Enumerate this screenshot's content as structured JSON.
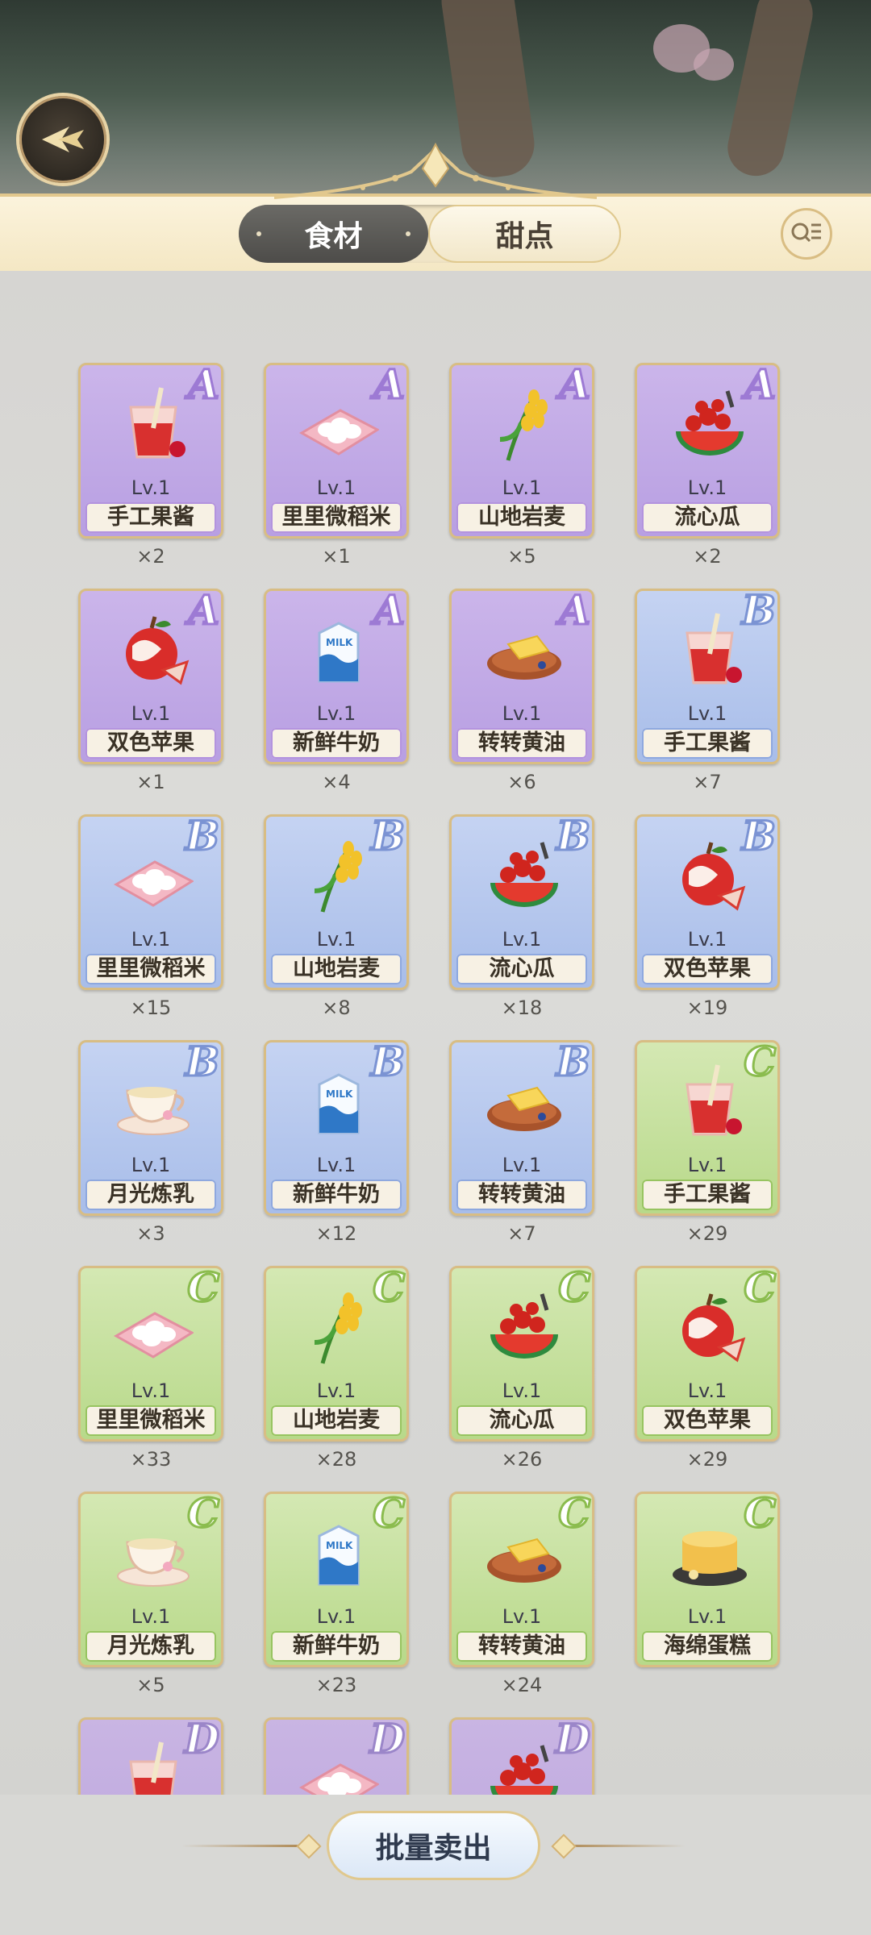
{
  "header": {
    "tabs": [
      {
        "label": "食材",
        "active": true
      },
      {
        "label": "甜点",
        "active": false
      }
    ]
  },
  "colors": {
    "rank_A": "#b89fe2",
    "rank_B": "#a8bde9",
    "rank_C": "#b8d98a",
    "rank_D": "#bca6de",
    "gold_trim": "#d8bd84"
  },
  "items": [
    {
      "name": "手工果酱",
      "level": "Lv.1",
      "rank": "A",
      "qty": "×2",
      "icon": "jam-drink-icon"
    },
    {
      "name": "里里微稻米",
      "level": "Lv.1",
      "rank": "A",
      "qty": "×1",
      "icon": "rice-icon"
    },
    {
      "name": "山地岩麦",
      "level": "Lv.1",
      "rank": "A",
      "qty": "×5",
      "icon": "wheat-icon"
    },
    {
      "name": "流心瓜",
      "level": "Lv.1",
      "rank": "A",
      "qty": "×2",
      "icon": "melon-icon"
    },
    {
      "name": "双色苹果",
      "level": "Lv.1",
      "rank": "A",
      "qty": "×1",
      "icon": "apple-icon"
    },
    {
      "name": "新鲜牛奶",
      "level": "Lv.1",
      "rank": "A",
      "qty": "×4",
      "icon": "milk-icon"
    },
    {
      "name": "转转黄油",
      "level": "Lv.1",
      "rank": "A",
      "qty": "×6",
      "icon": "butter-icon"
    },
    {
      "name": "手工果酱",
      "level": "Lv.1",
      "rank": "B",
      "qty": "×7",
      "icon": "jam-drink-icon"
    },
    {
      "name": "里里微稻米",
      "level": "Lv.1",
      "rank": "B",
      "qty": "×15",
      "icon": "rice-icon"
    },
    {
      "name": "山地岩麦",
      "level": "Lv.1",
      "rank": "B",
      "qty": "×8",
      "icon": "wheat-icon"
    },
    {
      "name": "流心瓜",
      "level": "Lv.1",
      "rank": "B",
      "qty": "×18",
      "icon": "melon-icon"
    },
    {
      "name": "双色苹果",
      "level": "Lv.1",
      "rank": "B",
      "qty": "×19",
      "icon": "apple-icon"
    },
    {
      "name": "月光炼乳",
      "level": "Lv.1",
      "rank": "B",
      "qty": "×3",
      "icon": "teacup-icon"
    },
    {
      "name": "新鲜牛奶",
      "level": "Lv.1",
      "rank": "B",
      "qty": "×12",
      "icon": "milk-icon"
    },
    {
      "name": "转转黄油",
      "level": "Lv.1",
      "rank": "B",
      "qty": "×7",
      "icon": "butter-icon"
    },
    {
      "name": "手工果酱",
      "level": "Lv.1",
      "rank": "C",
      "qty": "×29",
      "icon": "jam-drink-icon"
    },
    {
      "name": "里里微稻米",
      "level": "Lv.1",
      "rank": "C",
      "qty": "×33",
      "icon": "rice-icon"
    },
    {
      "name": "山地岩麦",
      "level": "Lv.1",
      "rank": "C",
      "qty": "×28",
      "icon": "wheat-icon"
    },
    {
      "name": "流心瓜",
      "level": "Lv.1",
      "rank": "C",
      "qty": "×26",
      "icon": "melon-icon"
    },
    {
      "name": "双色苹果",
      "level": "Lv.1",
      "rank": "C",
      "qty": "×29",
      "icon": "apple-icon"
    },
    {
      "name": "月光炼乳",
      "level": "Lv.1",
      "rank": "C",
      "qty": "×5",
      "icon": "teacup-icon"
    },
    {
      "name": "新鲜牛奶",
      "level": "Lv.1",
      "rank": "C",
      "qty": "×23",
      "icon": "milk-icon"
    },
    {
      "name": "转转黄油",
      "level": "Lv.1",
      "rank": "C",
      "qty": "×24",
      "icon": "butter-icon"
    },
    {
      "name": "海绵蛋糕",
      "level": "Lv.1",
      "rank": "C",
      "qty": "",
      "icon": "sponge-cake-icon"
    },
    {
      "name": "",
      "level": "",
      "rank": "D",
      "qty": "",
      "icon": "jam-drink-icon"
    },
    {
      "name": "",
      "level": "",
      "rank": "D",
      "qty": "",
      "icon": "rice-icon"
    },
    {
      "name": "",
      "level": "",
      "rank": "D",
      "qty": "",
      "icon": "melon-icon"
    }
  ],
  "footer": {
    "bulk_sell_label": "批量卖出"
  }
}
